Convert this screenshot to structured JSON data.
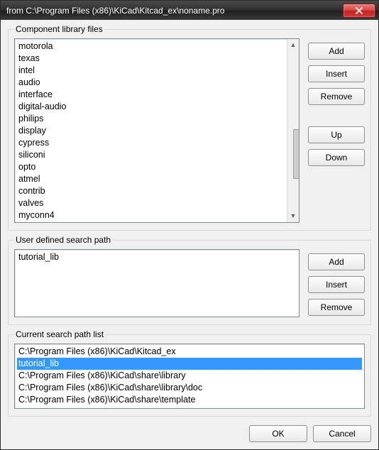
{
  "window": {
    "title": "from C:\\Program Files (x86)\\KiCad\\Kitcad_ex\\noname.pro"
  },
  "sections": {
    "component": {
      "legend": "Component library files",
      "items": [
        "motorola",
        "texas",
        "intel",
        "audio",
        "interface",
        "digital-audio",
        "philips",
        "display",
        "cypress",
        "siliconi",
        "opto",
        "atmel",
        "contrib",
        "valves",
        "myconn4"
      ],
      "buttons": {
        "add": "Add",
        "insert": "Insert",
        "remove": "Remove",
        "up": "Up",
        "down": "Down"
      }
    },
    "user": {
      "legend": "User defined search path",
      "items": [
        "tutorial_lib"
      ],
      "buttons": {
        "add": "Add",
        "insert": "Insert",
        "remove": "Remove"
      }
    },
    "current": {
      "legend": "Current search path list",
      "items": [
        "C:\\Program Files (x86)\\KiCad\\Kitcad_ex",
        "tutorial_lib",
        "C:\\Program Files (x86)\\KiCad\\share\\library",
        "C:\\Program Files (x86)\\KiCad\\share\\library\\doc",
        "C:\\Program Files (x86)\\KiCad\\share\\template"
      ],
      "selected_index": 1
    }
  },
  "footer": {
    "ok": "OK",
    "cancel": "Cancel"
  }
}
